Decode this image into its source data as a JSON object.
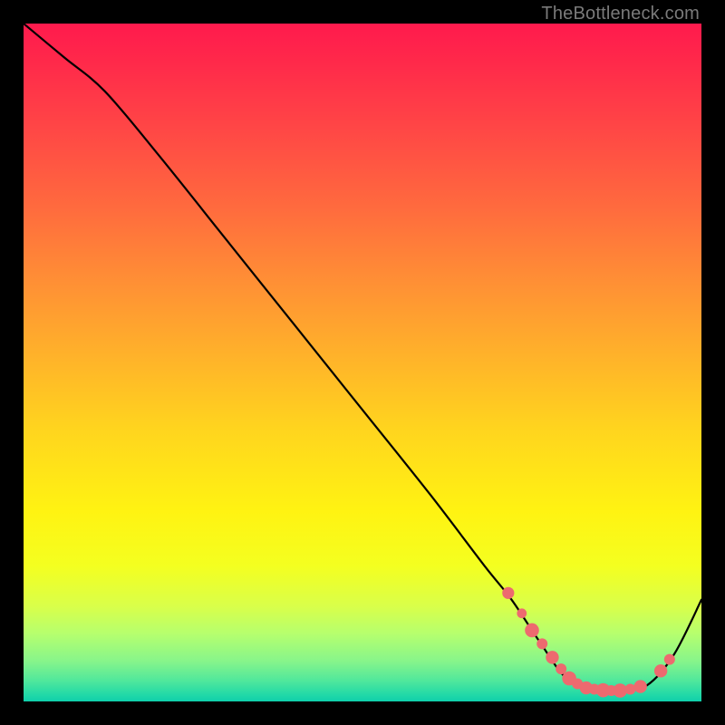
{
  "attribution": "TheBottleneck.com",
  "colors": {
    "background": "#000000",
    "curve": "#000000",
    "marker": "#ed6a6f",
    "attribution_text": "#7a7a7a"
  },
  "chart_data": {
    "type": "line",
    "title": "",
    "xlabel": "",
    "ylabel": "",
    "xlim": [
      0,
      100
    ],
    "ylim": [
      0,
      100
    ],
    "series": [
      {
        "name": "curve",
        "x": [
          0,
          6,
          12,
          20,
          30,
          40,
          50,
          60,
          68,
          72,
          76,
          80,
          84,
          88,
          92,
          96,
          100
        ],
        "y": [
          100,
          95,
          90,
          80.5,
          68,
          55.5,
          43,
          30.5,
          20,
          15,
          9,
          3.5,
          1.8,
          1.6,
          2.4,
          7,
          15
        ]
      }
    ],
    "markers": [
      {
        "x": 71.5,
        "y": 16,
        "r": 1.1
      },
      {
        "x": 73.5,
        "y": 13,
        "r": 0.9
      },
      {
        "x": 75,
        "y": 10.5,
        "r": 1.3
      },
      {
        "x": 76.5,
        "y": 8.5,
        "r": 1.0
      },
      {
        "x": 78,
        "y": 6.5,
        "r": 1.2
      },
      {
        "x": 79.3,
        "y": 4.8,
        "r": 1.0
      },
      {
        "x": 80.5,
        "y": 3.4,
        "r": 1.3
      },
      {
        "x": 81.7,
        "y": 2.6,
        "r": 1.0
      },
      {
        "x": 83,
        "y": 2.0,
        "r": 1.2
      },
      {
        "x": 84.2,
        "y": 1.8,
        "r": 1.0
      },
      {
        "x": 85.5,
        "y": 1.65,
        "r": 1.3
      },
      {
        "x": 86.7,
        "y": 1.6,
        "r": 1.0
      },
      {
        "x": 88,
        "y": 1.6,
        "r": 1.3
      },
      {
        "x": 89.5,
        "y": 1.8,
        "r": 1.0
      },
      {
        "x": 91,
        "y": 2.2,
        "r": 1.2
      },
      {
        "x": 94,
        "y": 4.5,
        "r": 1.2
      },
      {
        "x": 95.3,
        "y": 6.2,
        "r": 1.0
      }
    ]
  }
}
